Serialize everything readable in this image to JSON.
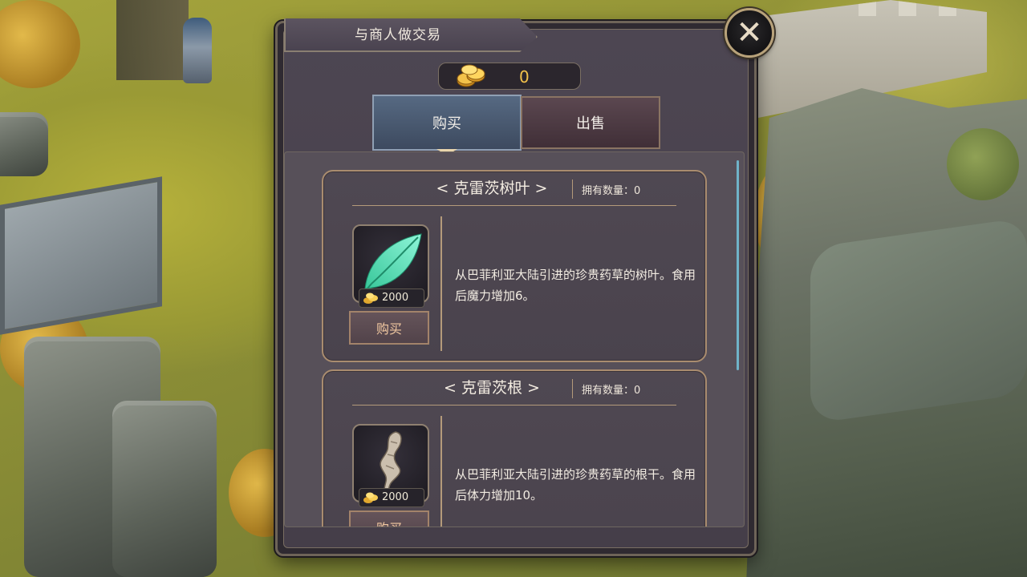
{
  "dialog": {
    "title": "与商人做交易",
    "currency": {
      "icon": "gold-coins-icon",
      "amount": "0"
    },
    "tabs": [
      {
        "label": "购买",
        "active": true
      },
      {
        "label": "出售",
        "active": false
      }
    ],
    "items": [
      {
        "name": "< 克雷茨树叶 >",
        "owned": "拥有数量：0",
        "icon": "leaf-icon",
        "price": "2000",
        "buy_label": "购买",
        "description": "从巴菲利亚大陆引进的珍贵药草的树叶。食用后魔力增加6。"
      },
      {
        "name": "< 克雷茨根 >",
        "owned": "拥有数量：0",
        "icon": "root-icon",
        "price": "2000",
        "buy_label": "购买",
        "description": "从巴菲利亚大陆引进的珍贵药草的根干。食用后体力增加10。"
      }
    ]
  },
  "colors": {
    "panel": "#4d4652",
    "accent_gold": "#f2c14a",
    "buy_tab": "#566982",
    "sell_tab": "#5b4750",
    "leaf": "#5fe0b8"
  }
}
